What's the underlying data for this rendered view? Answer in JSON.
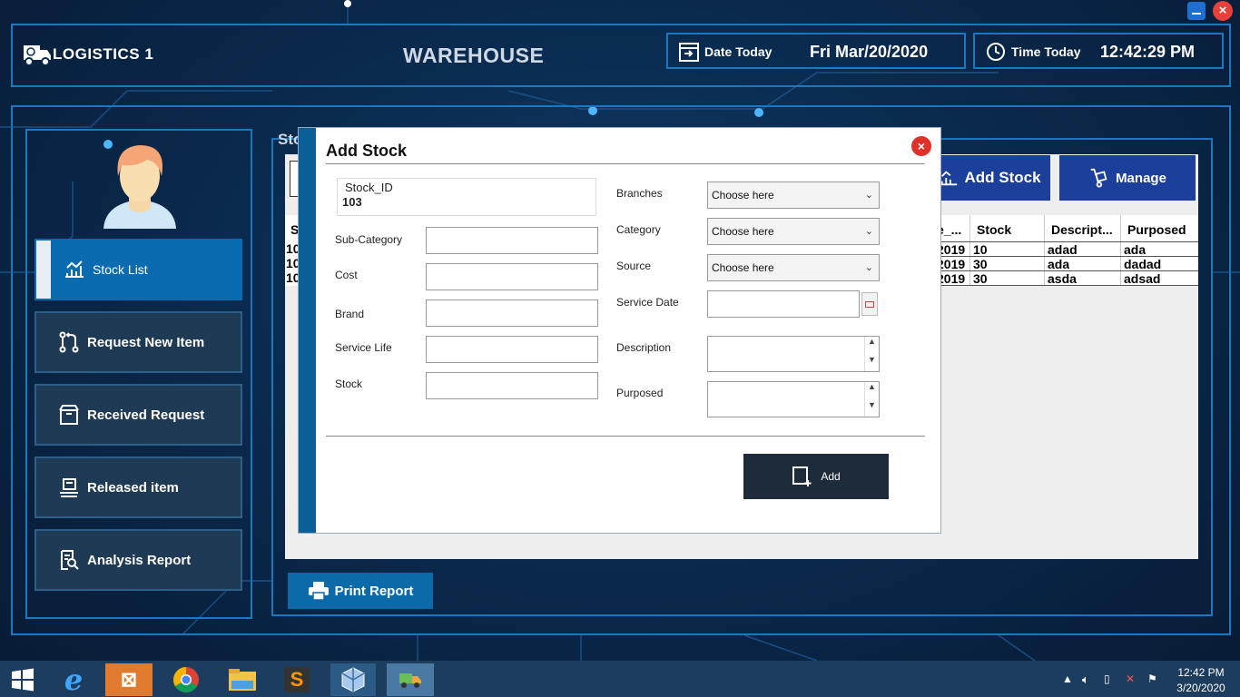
{
  "header": {
    "app_title": "LOGISTICS 1",
    "page_title": "WAREHOUSE",
    "date_label": "Date Today",
    "date_value": "Fri Mar/20/2020",
    "time_label": "Time Today",
    "time_value": "12:42:29 PM"
  },
  "sidebar": {
    "items": [
      {
        "label": "Stock List",
        "icon": "stock-list-icon"
      },
      {
        "label": "Request New Item",
        "icon": "request-icon"
      },
      {
        "label": "Received Request",
        "icon": "box-icon"
      },
      {
        "label": "Released item",
        "icon": "conveyor-icon"
      },
      {
        "label": "Analysis Report",
        "icon": "report-search-icon"
      }
    ]
  },
  "content": {
    "heading": "Sto",
    "add_stock_label": "Add Stock",
    "manage_label": "Manage",
    "print_label": "Print Report",
    "table": {
      "columns": [
        "S",
        "e_...",
        "Stock",
        "Descript...",
        "Purposed"
      ],
      "rows": [
        {
          "id": "10",
          "date": "2019",
          "stock": "10",
          "description": "adad",
          "purposed": "ada"
        },
        {
          "id": "10",
          "date": "2019",
          "stock": "30",
          "description": "ada",
          "purposed": "dadad"
        },
        {
          "id": "10",
          "date": "2019",
          "stock": "30",
          "description": "asda",
          "purposed": "adsad"
        }
      ]
    }
  },
  "modal": {
    "title": "Add Stock",
    "stock_id_label": "Stock_ID",
    "stock_id_value": "103",
    "fields_left": [
      "Sub-Category",
      "Cost",
      "Brand",
      "Service Life",
      "Stock"
    ],
    "branches_label": "Branches",
    "category_label": "Category",
    "source_label": "Source",
    "service_date_label": "Service Date",
    "description_label": "Description",
    "purposed_label": "Purposed",
    "select_placeholder": "Choose here",
    "add_button_label": "Add"
  },
  "taskbar": {
    "clock_time": "12:42 PM",
    "clock_date": "3/20/2020"
  },
  "colors": {
    "accent_blue": "#1a78c2",
    "nav_active": "#0a6bb0",
    "button_blue": "#1c3f9c",
    "close_red": "#e0302a"
  }
}
